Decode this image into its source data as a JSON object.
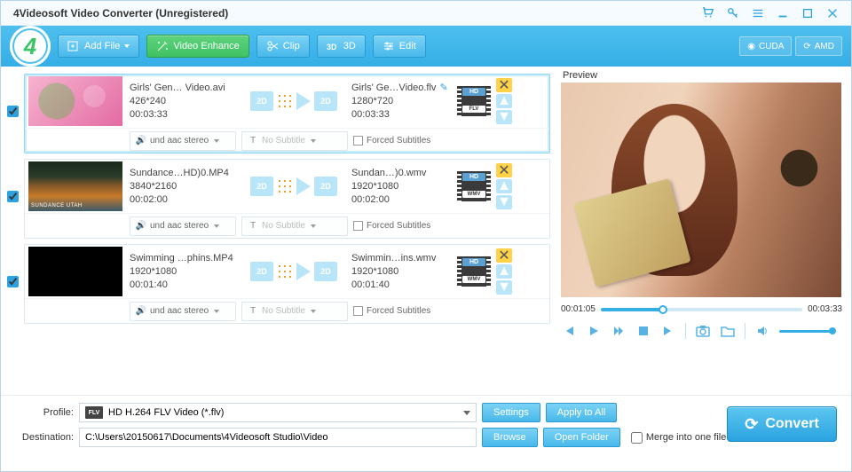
{
  "window": {
    "title": "4Videosoft Video Converter (Unregistered)"
  },
  "toolbar": {
    "add_file": "Add File",
    "video_enhance": "Video Enhance",
    "clip": "Clip",
    "three_d": "3D",
    "edit": "Edit",
    "cuda": "CUDA",
    "amd": "AMD"
  },
  "preview": {
    "label": "Preview",
    "time_current": "00:01:05",
    "time_total": "00:03:33"
  },
  "items": [
    {
      "checked": true,
      "src_name": "Girls' Gen… Video.avi",
      "src_res": "426*240",
      "src_dur": "00:03:33",
      "dst_name": "Girls' Ge…Video.flv",
      "dst_res": "1280*720",
      "dst_dur": "00:03:33",
      "fmt_top": "HD",
      "fmt_bot": "FLV",
      "audio": "und aac stereo",
      "subtitle": "No Subtitle",
      "forced": "Forced Subtitles",
      "editable": true
    },
    {
      "checked": true,
      "src_name": "Sundance…HD)0.MP4",
      "src_res": "3840*2160",
      "src_dur": "00:02:00",
      "dst_name": "Sundan…)0.wmv",
      "dst_res": "1920*1080",
      "dst_dur": "00:02:00",
      "fmt_top": "HD",
      "fmt_bot": "WMV",
      "audio": "und aac stereo",
      "subtitle": "No Subtitle",
      "forced": "Forced Subtitles",
      "editable": false
    },
    {
      "checked": true,
      "src_name": "Swimming …phins.MP4",
      "src_res": "1920*1080",
      "src_dur": "00:01:40",
      "dst_name": "Swimmin…ins.wmv",
      "dst_res": "1920*1080",
      "dst_dur": "00:01:40",
      "fmt_top": "HD",
      "fmt_bot": "WMV",
      "audio": "und aac stereo",
      "subtitle": "No Subtitle",
      "forced": "Forced Subtitles",
      "editable": false
    }
  ],
  "bottom": {
    "profile_lbl": "Profile:",
    "profile_val": "HD H.264 FLV Video (*.flv)",
    "profile_badge": "FLV",
    "settings": "Settings",
    "apply_all": "Apply to All",
    "dest_lbl": "Destination:",
    "dest_val": "C:\\Users\\20150617\\Documents\\4Videosoft Studio\\Video",
    "browse": "Browse",
    "open_folder": "Open Folder",
    "merge": "Merge into one file",
    "convert": "Convert"
  },
  "dim2d": "2D"
}
